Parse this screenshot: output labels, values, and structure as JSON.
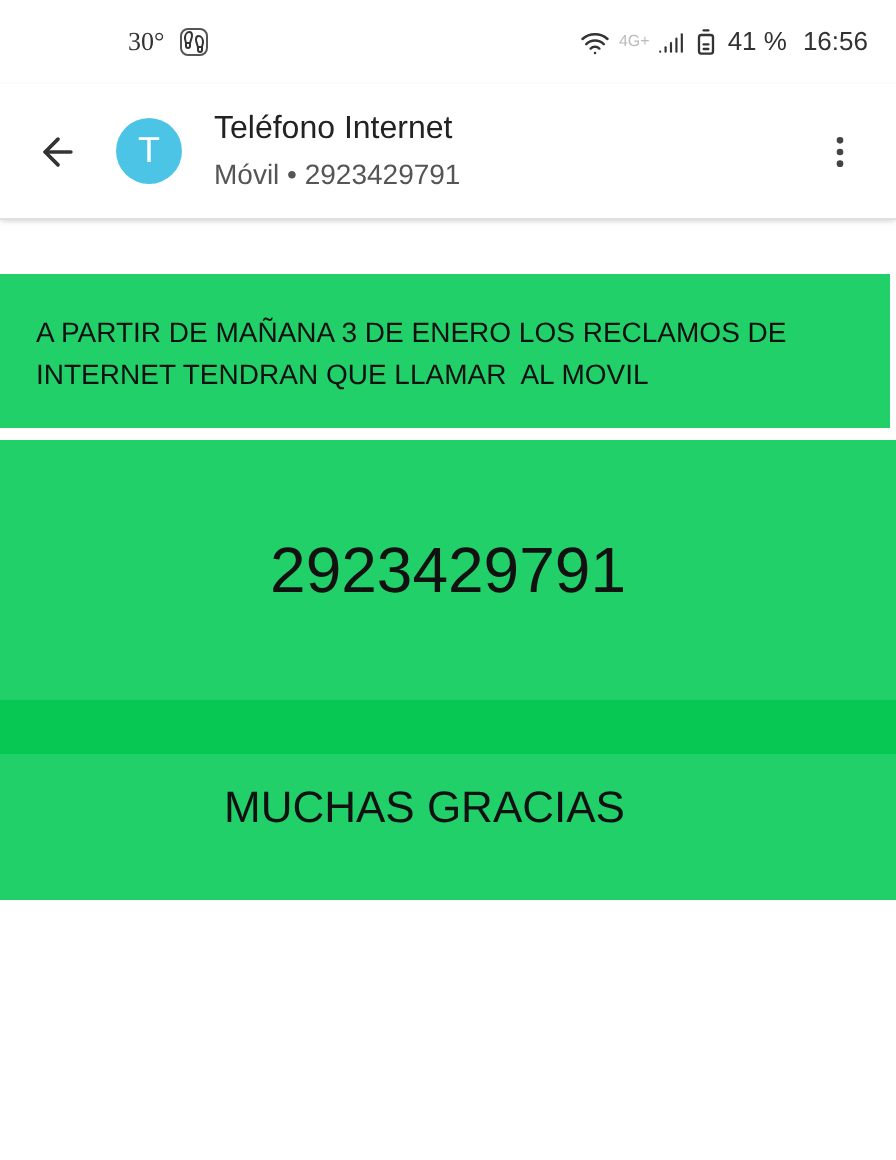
{
  "status_bar": {
    "temperature": "30°",
    "network": "4G+",
    "battery": "41 %",
    "time": "16:56"
  },
  "header": {
    "avatar_letter": "T",
    "title": "Teléfono Internet",
    "subtitle": "Móvil • 2923429791"
  },
  "message_image": {
    "notice": "A PARTIR DE MAÑANA 3 DE ENERO LOS RECLAMOS DE INTERNET TENDRAN QUE LLAMAR  AL MOVIL",
    "number": "2923429791",
    "thanks": "MUCHAS GRACIAS"
  }
}
